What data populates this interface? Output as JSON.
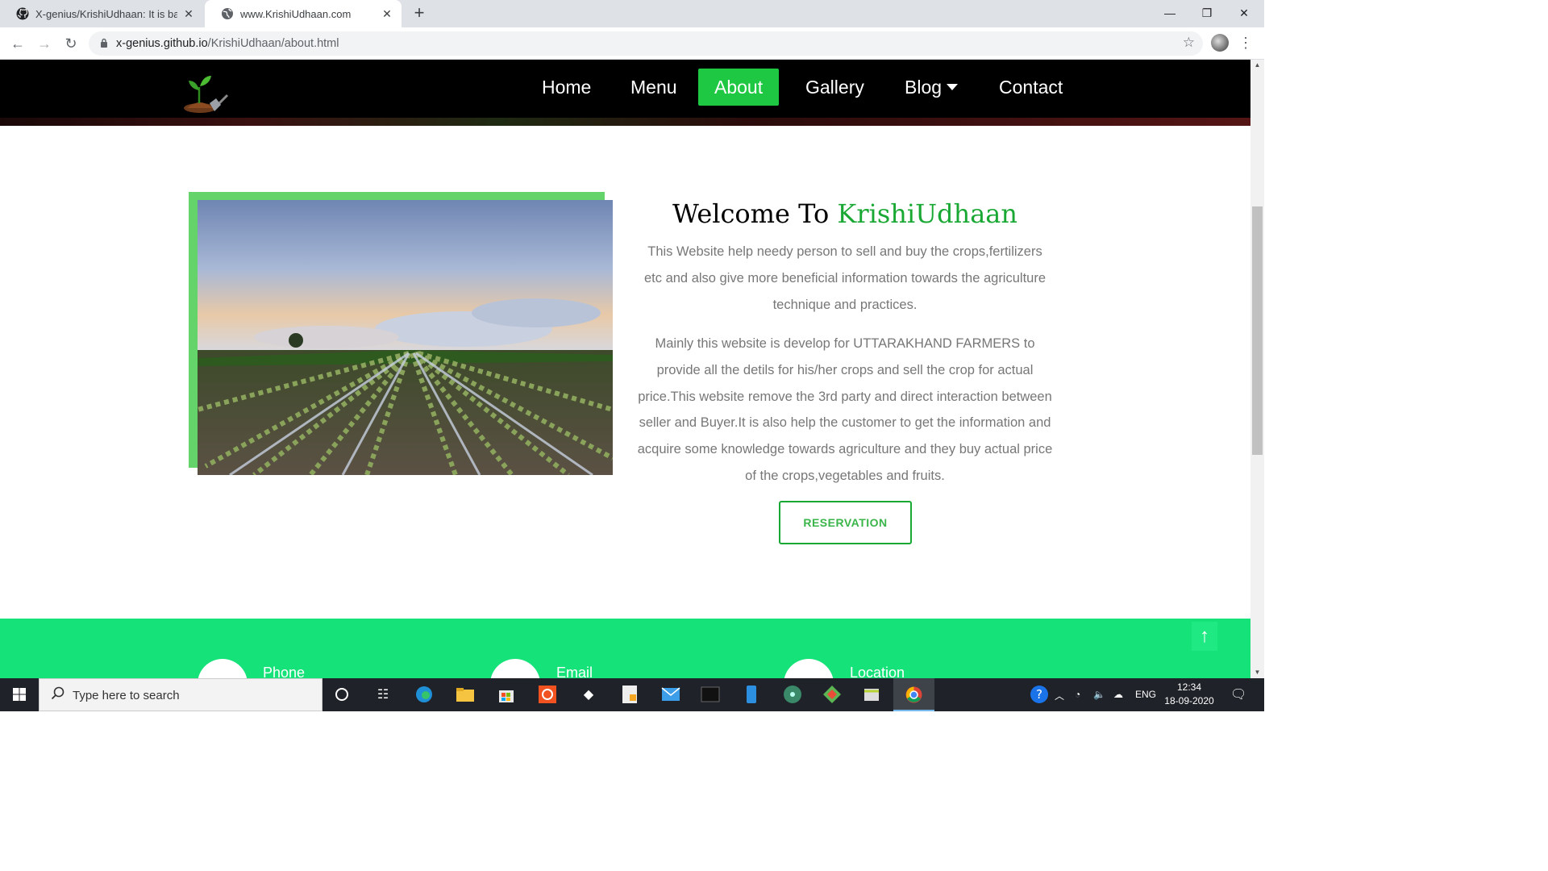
{
  "browser": {
    "tabs": [
      {
        "title": "X-genius/KrishiUdhaan: It is based",
        "favicon": "github-icon",
        "active": false
      },
      {
        "title": "www.KrishiUdhaan.com",
        "favicon": "globe-icon",
        "active": true
      }
    ],
    "url_host": "x-genius.github.io",
    "url_path": "/KrishiUdhaan/about.html"
  },
  "site": {
    "nav": [
      {
        "label": "Home",
        "active": false
      },
      {
        "label": "Menu",
        "active": false
      },
      {
        "label": "About",
        "active": true
      },
      {
        "label": "Gallery",
        "active": false
      },
      {
        "label": "Blog",
        "active": false,
        "dropdown": true
      },
      {
        "label": "Contact",
        "active": false
      }
    ],
    "about": {
      "heading_prefix": "Welcome To",
      "heading_brand": "KrishiUdhaan",
      "paragraph1": "This Website help needy person to sell and buy the crops,fertilizers etc and also give more beneficial information towards the agriculture technique and practices.",
      "paragraph2": "Mainly this website is develop for UTTARAKHAND FARMERS to provide all the detils for his/her crops and sell the crop for actual price.This website remove the 3rd party and direct interaction between seller and Buyer.It is also help the customer to get the information and acquire some knowledge towards agriculture and they buy actual price of the crops,vegetables and fruits.",
      "button": "RESERVATION"
    },
    "contact": [
      {
        "label": "Phone",
        "icon": "phone-icon"
      },
      {
        "label": "Email",
        "icon": "email-icon"
      },
      {
        "label": "Location",
        "icon": "location-icon"
      }
    ],
    "colors": {
      "accent": "#1ec843",
      "band": "#16e27a",
      "brand_text": "#1aa834"
    }
  },
  "taskbar": {
    "search_placeholder": "Type here to search",
    "language": "ENG",
    "time": "12:34",
    "date": "18-09-2020"
  }
}
